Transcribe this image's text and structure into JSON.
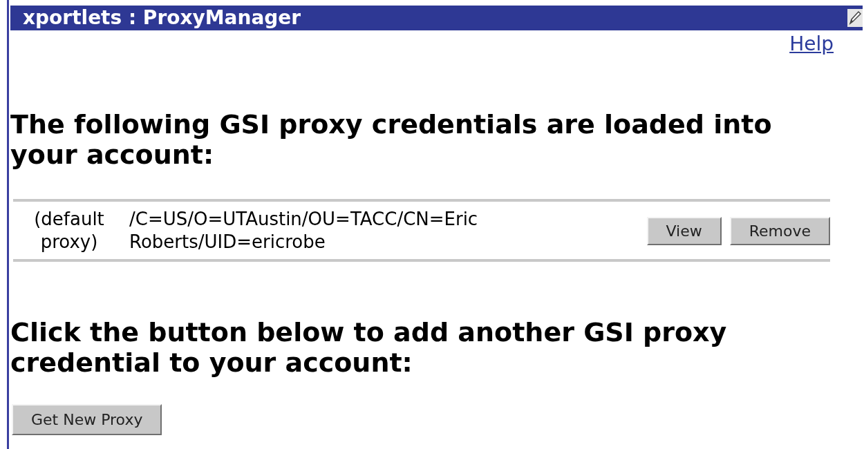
{
  "portlet": {
    "title": "xportlets : ProxyManager",
    "help_link": "Help"
  },
  "loaded_heading": "The following GSI proxy credentials are loaded into your account:",
  "credentials": [
    {
      "label": "(default proxy)",
      "subject": "/C=US/O=UTAustin/OU=TACC/CN=Eric Roberts/UID=ericrobe",
      "buttons": [
        "View",
        "Remove"
      ]
    }
  ],
  "add_heading": "Click the button below to add another GSI proxy credential to your account:",
  "add_button": "Get New Proxy"
}
